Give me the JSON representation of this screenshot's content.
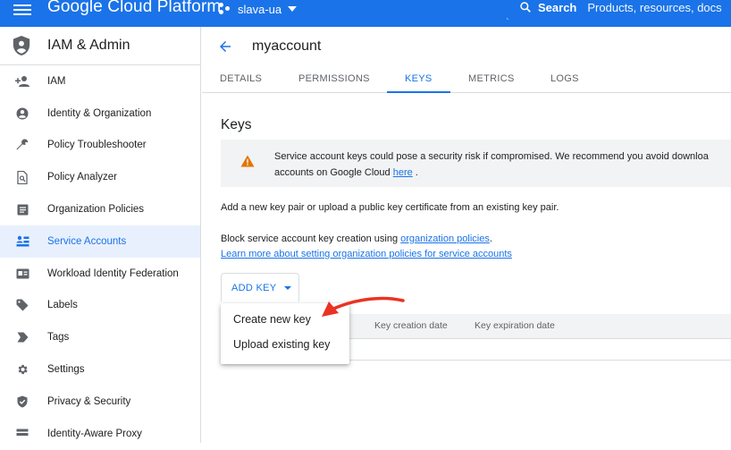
{
  "topbar": {
    "brand": "Google Cloud Platform",
    "project": "slava-ua",
    "search_label": "Search",
    "search_placeholder": "Products, resources, docs"
  },
  "sidebar": {
    "title": "IAM & Admin",
    "items": [
      {
        "label": "IAM",
        "icon": "person-add-icon"
      },
      {
        "label": "Identity & Organization",
        "icon": "account-circle-icon"
      },
      {
        "label": "Policy Troubleshooter",
        "icon": "wrench-icon"
      },
      {
        "label": "Policy Analyzer",
        "icon": "document-search-icon"
      },
      {
        "label": "Organization Policies",
        "icon": "list-document-icon"
      },
      {
        "label": "Service Accounts",
        "icon": "service-account-icon",
        "active": true
      },
      {
        "label": "Workload Identity Federation",
        "icon": "id-card-icon"
      },
      {
        "label": "Labels",
        "icon": "label-icon"
      },
      {
        "label": "Tags",
        "icon": "tag-icon"
      },
      {
        "label": "Settings",
        "icon": "gear-icon"
      },
      {
        "label": "Privacy & Security",
        "icon": "shield-icon"
      },
      {
        "label": "Identity-Aware Proxy",
        "icon": "proxy-icon"
      }
    ]
  },
  "page": {
    "title": "myaccount",
    "tabs": [
      "DETAILS",
      "PERMISSIONS",
      "KEYS",
      "METRICS",
      "LOGS"
    ],
    "active_tab": "KEYS",
    "section_title": "Keys",
    "warning_line1": "Service account keys could pose a security risk if compromised. We recommend you avoid downloa",
    "warning_line2_prefix": "accounts on Google Cloud ",
    "warning_link": "here",
    "warning_line2_suffix": " .",
    "info1": "Add a new key pair or upload a public key certificate from an existing key pair.",
    "info2_prefix": "Block service account key creation using ",
    "info2_link": "organization policies",
    "info2_suffix": ".",
    "info3_link": "Learn more about setting organization policies for service accounts",
    "add_key_label": "ADD KEY",
    "table_headers": [
      "Key creation date",
      "Key expiration date"
    ],
    "dropdown": [
      "Create new key",
      "Upload existing key"
    ]
  },
  "colors": {
    "brand_blue": "#1a73e8",
    "warning_orange": "#e37400",
    "annotation_red": "#ea3323"
  }
}
